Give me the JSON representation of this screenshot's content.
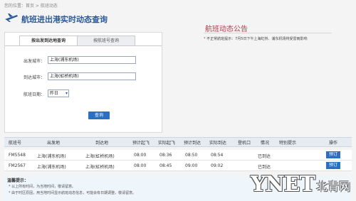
{
  "breadcrumb": "您的位置：首页 > 航班动态",
  "page_title": "航班进出港实时动态查询",
  "tabs": [
    "按出发到达地查询",
    "按航班号查询"
  ],
  "form": {
    "departure_label": "出发城市：",
    "departure_value": "上海(浦东机场)",
    "arrival_label": "到达城市：",
    "arrival_value": "上海(虹桥机场)",
    "date_label": "航班日期：",
    "date_value": "昨日",
    "query_button": "查询"
  },
  "notice": {
    "title": "航班动态公告",
    "text": "不正常航班提示：7月5日下午上海虹桥、浦东机场将受雷雨影响"
  },
  "table": {
    "headers": [
      "航班号",
      "出发地",
      "到达地",
      "预计起飞",
      "实际起飞",
      "预计到达",
      "实际到达",
      "登机口",
      "情况",
      "特别提示",
      "操作"
    ],
    "rows": [
      {
        "flight": "FM5548",
        "from": "上海(浦东机场)",
        "to": "上海(虹桥机场)",
        "sched_dep": "08:00",
        "act_dep": "08:36",
        "sched_arr": "08:50",
        "act_arr": "08:54",
        "gate": "",
        "status": "已到达",
        "note": "",
        "action": "预订"
      },
      {
        "flight": "FM2567",
        "from": "上海(浦东机场)",
        "to": "上海(虹桥机场)",
        "sched_dep": "08:00",
        "act_dep": "08:45",
        "sched_arr": "09:00",
        "act_arr": "09:02",
        "gate": "",
        "status": "已到达",
        "note": "",
        "action": "预订"
      }
    ]
  },
  "tips": {
    "title": "温馨提示：",
    "items": [
      "以上所有时间，为当地时间，敬请留意。",
      "由于时区原因，用当地时间显示航班动态信息，可能会有日期调整，敬请留意。"
    ]
  },
  "watermark": {
    "main": "YNET",
    "sub": "北青网"
  }
}
